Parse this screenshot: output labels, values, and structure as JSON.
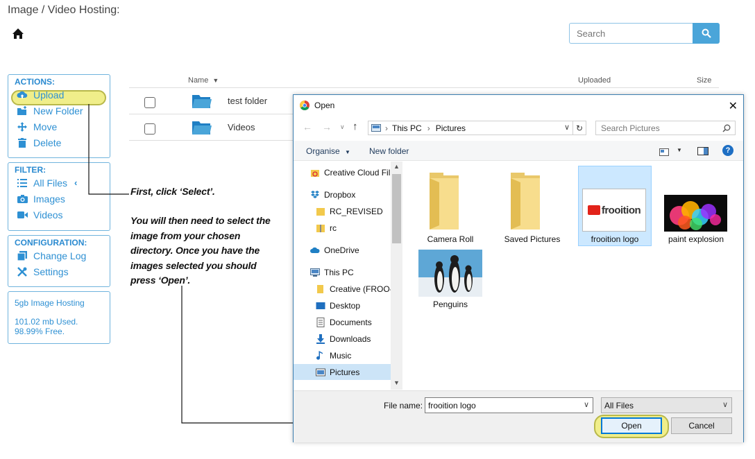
{
  "app": {
    "title": "Image / Video Hosting:",
    "search_placeholder": "Search",
    "accent": "#2e90d3"
  },
  "sidebar": {
    "actions_header": "ACTIONS:",
    "actions": [
      {
        "label": "Upload",
        "icon": "cloud-upload-icon"
      },
      {
        "label": "New Folder",
        "icon": "new-folder-icon"
      },
      {
        "label": "Move",
        "icon": "move-icon"
      },
      {
        "label": "Delete",
        "icon": "trash-icon"
      }
    ],
    "filter_header": "FILTER:",
    "filters": [
      {
        "label": "All Files",
        "icon": "list-icon"
      },
      {
        "label": "Images",
        "icon": "camera-icon"
      },
      {
        "label": "Videos",
        "icon": "video-icon"
      }
    ],
    "config_header": "CONFIGURATION:",
    "config": [
      {
        "label": "Change Log",
        "icon": "copy-icon"
      },
      {
        "label": "Settings",
        "icon": "tools-icon"
      }
    ],
    "storage": {
      "plan": "5gb Image Hosting",
      "used": "101.02 mb Used.",
      "free": "98.99% Free."
    }
  },
  "file_list": {
    "columns": {
      "name": "Name",
      "uploaded": "Uploaded",
      "size": "Size"
    },
    "rows": [
      {
        "name": "test folder"
      },
      {
        "name": "Videos"
      }
    ]
  },
  "annotation": {
    "step1": "First, click ‘Select’.",
    "step2_lines": [
      "You will then need to select the",
      "image from your chosen",
      "directory. Once you have the",
      "images selected you should",
      "press ‘Open’."
    ]
  },
  "dialog": {
    "title": "Open",
    "breadcrumb": [
      "This PC",
      "Pictures"
    ],
    "search_placeholder": "Search Pictures",
    "toolbar": {
      "organise": "Organise",
      "new_folder": "New folder"
    },
    "nav": [
      "Creative Cloud Fil",
      "Dropbox",
      "RC_REVISED",
      "rc",
      "OneDrive",
      "This PC",
      "Creative (FROO-",
      "Desktop",
      "Documents",
      "Downloads",
      "Music",
      "Pictures"
    ],
    "items": [
      {
        "label": "Camera Roll",
        "kind": "folder"
      },
      {
        "label": "Saved Pictures",
        "kind": "folder"
      },
      {
        "label": "frooition logo",
        "kind": "image",
        "selected": true
      },
      {
        "label": "paint explosion",
        "kind": "image"
      },
      {
        "label": "Penguins",
        "kind": "image"
      }
    ],
    "logo_text": "frooition",
    "file_name_label": "File name:",
    "file_name_value": "frooition logo",
    "file_type": "All Files",
    "open_label": "Open",
    "cancel_label": "Cancel"
  }
}
